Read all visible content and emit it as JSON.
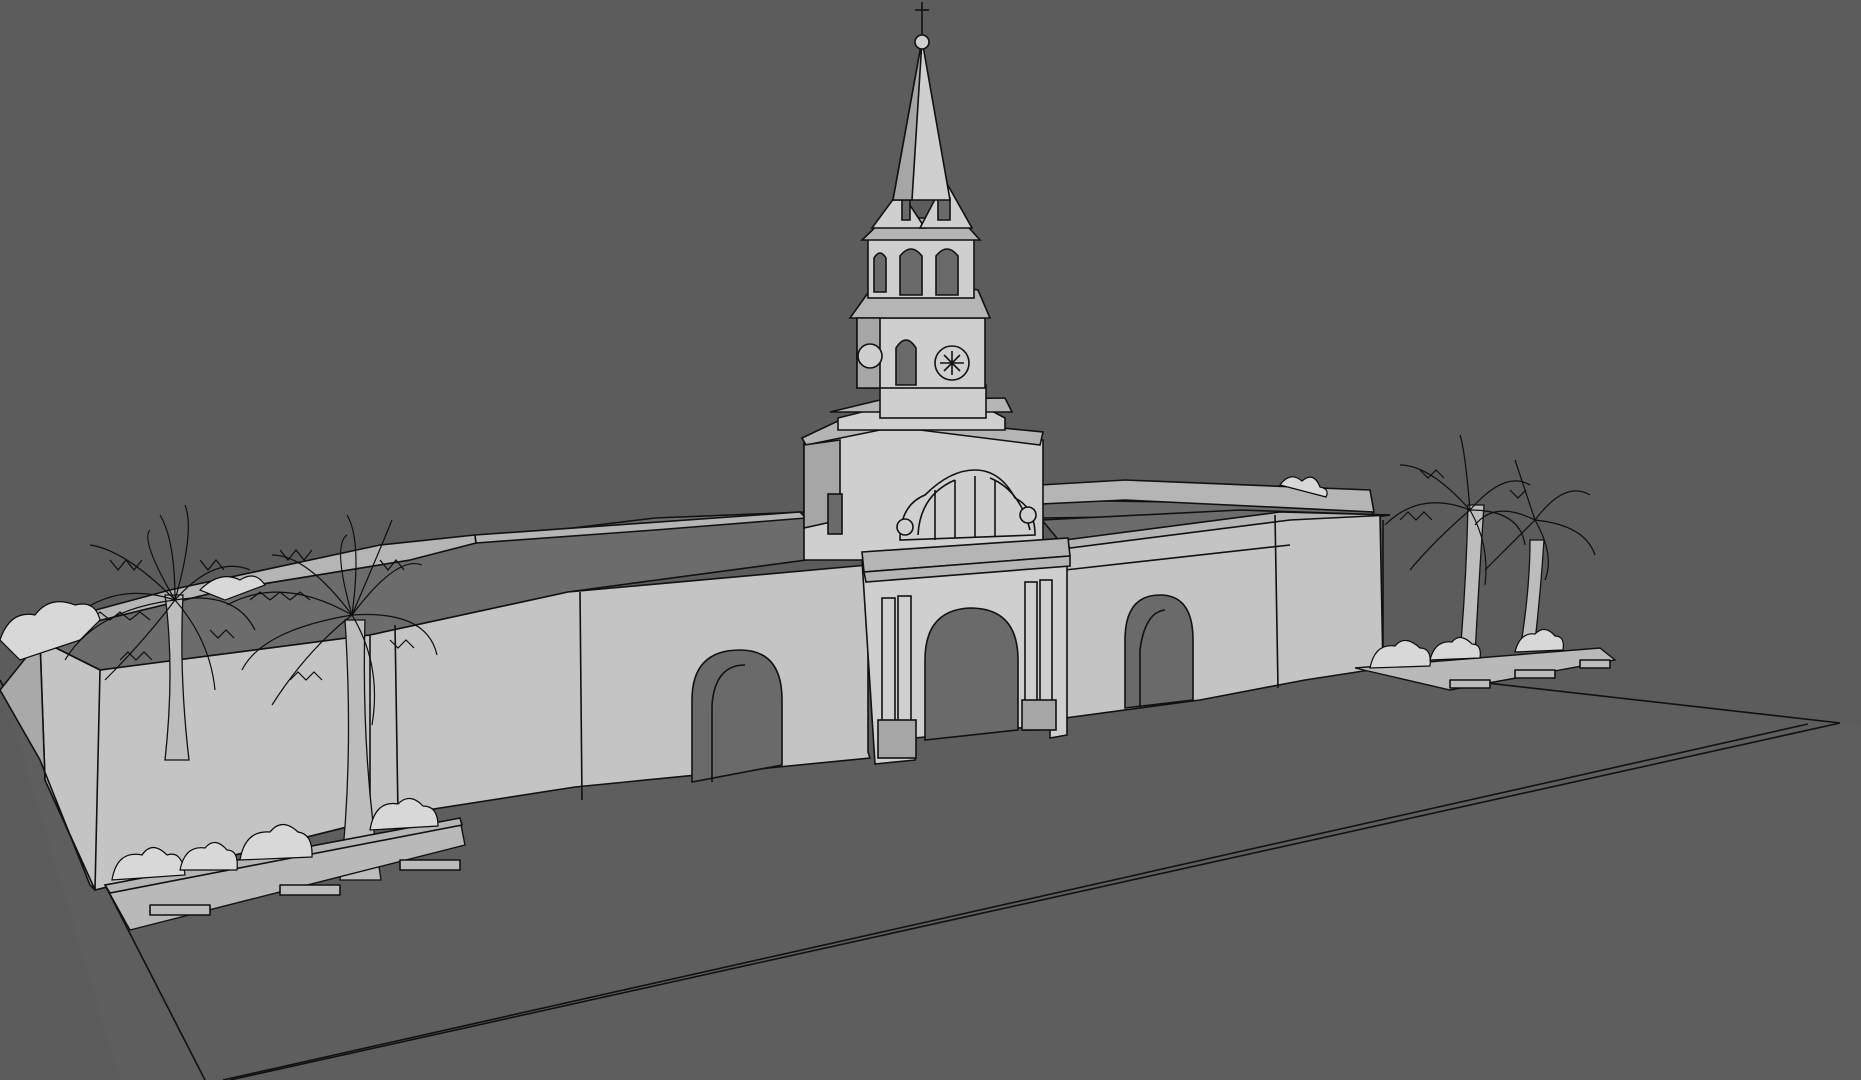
{
  "scene": {
    "background_color": "#5c5c5c",
    "ground_color": "#5e5e5e",
    "wall_color": "#c4c4c4",
    "line_color": "#111111",
    "objects": [
      "clock-tower",
      "city-wall",
      "arched-gateway",
      "palm-trees",
      "planters"
    ]
  }
}
